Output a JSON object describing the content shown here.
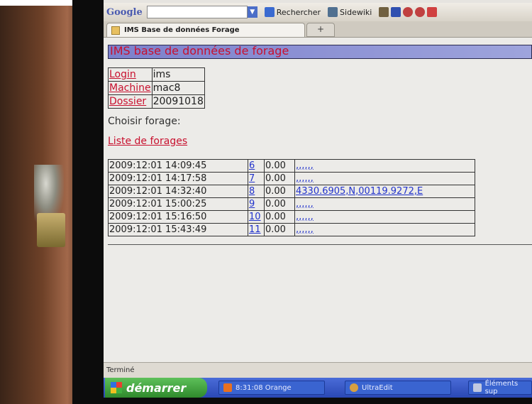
{
  "toolbar": {
    "logo": "Google",
    "search_button": "Rechercher",
    "sidewiki_button": "Sidewiki"
  },
  "tabs": [
    {
      "label": "IMS Base de données Forage"
    }
  ],
  "new_tab_label": "+",
  "page": {
    "heading": "IMS base de données de forage",
    "info": [
      {
        "label": "Login",
        "value": "ims"
      },
      {
        "label": "Machine",
        "value": "mac8"
      },
      {
        "label": "Dossier",
        "value": "20091018"
      }
    ],
    "choose_label": "Choisir forage:",
    "list_link": "Liste de forages",
    "borings": [
      {
        "datetime": "2009:12:01 14:09:45",
        "num": "6",
        "depth": "0.00",
        "coord": ",,,,,,"
      },
      {
        "datetime": "2009:12:01 14:17:58",
        "num": "7",
        "depth": "0.00",
        "coord": ",,,,,,"
      },
      {
        "datetime": "2009:12:01 14:32:40",
        "num": "8",
        "depth": "0.00",
        "coord": "4330.6905,N,00119.9272,E"
      },
      {
        "datetime": "2009:12:01 15:00:25",
        "num": "9",
        "depth": "0.00",
        "coord": ",,,,,,"
      },
      {
        "datetime": "2009:12:01 15:16:50",
        "num": "10",
        "depth": "0.00",
        "coord": ",,,,,,"
      },
      {
        "datetime": "2009:12:01 15:43:49",
        "num": "11",
        "depth": "0.00",
        "coord": ",,,,,,"
      }
    ]
  },
  "status": "Terminé",
  "taskbar": {
    "start": "démarrer",
    "items": [
      {
        "label": "8:31:08 Orange"
      },
      {
        "label": "UltraEdit"
      },
      {
        "label": "Éléments sup"
      }
    ]
  },
  "colors": {
    "link_red": "#c8102e",
    "link_blue": "#2233cc",
    "banner": "#8a90d4",
    "taskbar": "#2a48b4",
    "start_green": "#3a9a36"
  }
}
